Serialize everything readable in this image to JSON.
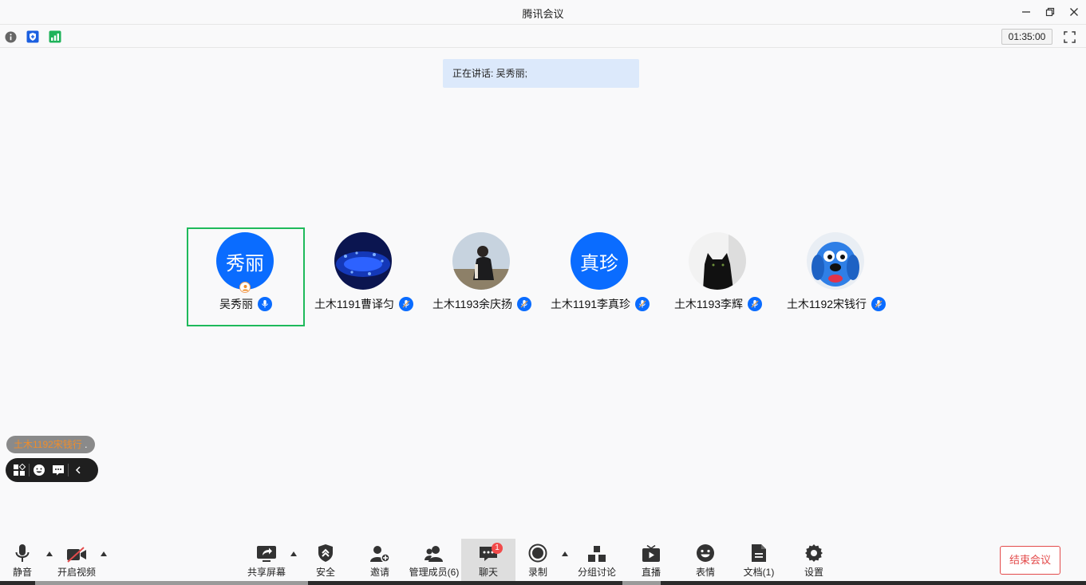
{
  "window": {
    "title": "腾讯会议",
    "minimize_icon": "minimize-icon",
    "restore_icon": "restore-icon",
    "close_icon": "close-icon"
  },
  "infobar": {
    "timer": "01:35:00"
  },
  "speaking": {
    "text": "正在讲话: 吴秀丽;"
  },
  "participants": [
    {
      "name": "吴秀丽",
      "avatar_text": "秀丽",
      "avatar_type": "text",
      "host": true,
      "active": true
    },
    {
      "name": "土木1191曹译匀",
      "avatar_type": "image",
      "image": "blue-lights-photo"
    },
    {
      "name": "土木1193余庆扬",
      "avatar_type": "image",
      "image": "person-photo"
    },
    {
      "name": "土木1191李真珍",
      "avatar_text": "真珍",
      "avatar_type": "text"
    },
    {
      "name": "土木1193李辉",
      "avatar_type": "image",
      "image": "black-cat-photo"
    },
    {
      "name": "土木1192宋钱行",
      "avatar_type": "image",
      "image": "blue-dog-cartoon"
    }
  ],
  "float_tag": {
    "name": "土木1192宋钱行",
    "suffix": "."
  },
  "toolbar": {
    "mute": "静音",
    "video": "开启视频",
    "share": "共享屏幕",
    "security": "安全",
    "invite": "邀请",
    "members": "管理成员(6)",
    "chat": "聊天",
    "chat_badge": "1",
    "record": "录制",
    "breakout": "分组讨论",
    "live": "直播",
    "reactions": "表情",
    "docs": "文档(1)",
    "settings": "设置",
    "end": "结束会议"
  },
  "colors": {
    "accent": "#0a6cff",
    "active_border": "#1fba5b",
    "end": "#e34b4b",
    "badge": "#f24b4b"
  }
}
